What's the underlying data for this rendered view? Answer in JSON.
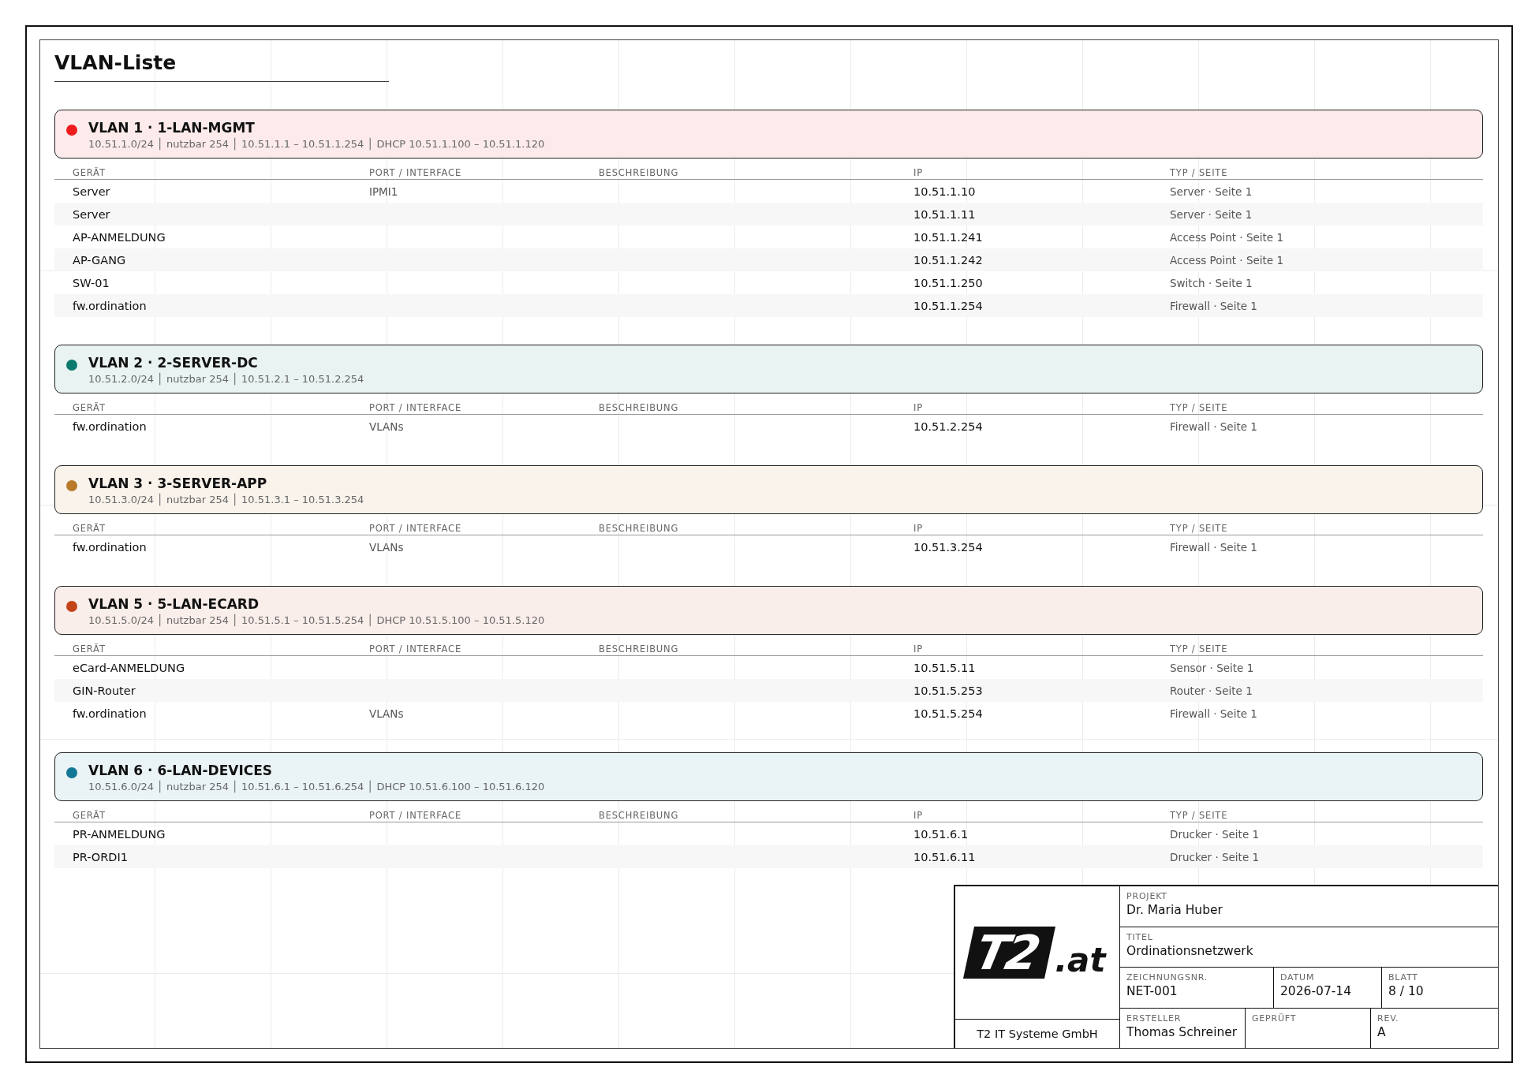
{
  "title": "VLAN-Liste",
  "vlans": [
    {
      "name": "VLAN 1 · 1-LAN-MGMT",
      "color": "#ee1c1c",
      "details": "10.51.1.0/24 │ nutzbar 254 │ 10.51.1.1 – 10.51.1.254 │ DHCP 10.51.1.100 – 10.51.1.120",
      "columns": [
        "GERÄT",
        "PORT / INTERFACE",
        "BESCHREIBUNG",
        "IP",
        "TYP / SEITE"
      ],
      "rows": [
        {
          "device": "Server",
          "port": "IPMI1",
          "ip": "10.51.1.10",
          "type": "Server · Seite 1"
        },
        {
          "device": "Server",
          "ip": "10.51.1.11",
          "type": "Server · Seite 1"
        },
        {
          "device": "AP-ANMELDUNG",
          "ip": "10.51.1.241",
          "type": "Access Point · Seite 1"
        },
        {
          "device": "AP-GANG",
          "ip": "10.51.1.242",
          "type": "Access Point · Seite 1"
        },
        {
          "device": "SW-01",
          "ip": "10.51.1.250",
          "type": "Switch · Seite 1"
        },
        {
          "device": "fw.ordination",
          "ip": "10.51.1.254",
          "type": "Firewall · Seite 1"
        }
      ]
    },
    {
      "name": "VLAN 2 · 2-SERVER-DC",
      "color": "#0e7a6e",
      "details": "10.51.2.0/24 │ nutzbar 254 │ 10.51.2.1 – 10.51.2.254",
      "columns": [
        "GERÄT",
        "PORT / INTERFACE",
        "BESCHREIBUNG",
        "IP",
        "TYP / SEITE"
      ],
      "rows": [
        {
          "device": "fw.ordination",
          "port": "VLANs",
          "ip": "10.51.2.254",
          "type": "Firewall · Seite 1"
        }
      ]
    },
    {
      "name": "VLAN 3 · 3-SERVER-APP",
      "color": "#b87a2a",
      "details": "10.51.3.0/24 │ nutzbar 254 │ 10.51.3.1 – 10.51.3.254",
      "columns": [
        "GERÄT",
        "PORT / INTERFACE",
        "BESCHREIBUNG",
        "IP",
        "TYP / SEITE"
      ],
      "rows": [
        {
          "device": "fw.ordination",
          "port": "VLANs",
          "ip": "10.51.3.254",
          "type": "Firewall · Seite 1"
        }
      ]
    },
    {
      "name": "VLAN 5 · 5-LAN-ECARD",
      "color": "#c4441a",
      "details": "10.51.5.0/24 │ nutzbar 254 │ 10.51.5.1 – 10.51.5.254 │ DHCP 10.51.5.100 – 10.51.5.120",
      "columns": [
        "GERÄT",
        "PORT / INTERFACE",
        "BESCHREIBUNG",
        "IP",
        "TYP / SEITE"
      ],
      "rows": [
        {
          "device": "eCard-ANMELDUNG",
          "ip": "10.51.5.11",
          "type": "Sensor · Seite 1"
        },
        {
          "device": "GIN-Router",
          "ip": "10.51.5.253",
          "type": "Router · Seite 1"
        },
        {
          "device": "fw.ordination",
          "port": "VLANs",
          "ip": "10.51.5.254",
          "type": "Firewall · Seite 1"
        }
      ]
    },
    {
      "name": "VLAN 6 · 6-LAN-DEVICES",
      "color": "#137895",
      "details": "10.51.6.0/24 │ nutzbar 254 │ 10.51.6.1 – 10.51.6.254 │ DHCP 10.51.6.100 – 10.51.6.120",
      "columns": [
        "GERÄT",
        "PORT / INTERFACE",
        "BESCHREIBUNG",
        "IP",
        "TYP / SEITE"
      ],
      "rows": [
        {
          "device": "PR-ANMELDUNG",
          "ip": "10.51.6.1",
          "type": "Drucker · Seite 1"
        },
        {
          "device": "PR-ORDI1",
          "ip": "10.51.6.11",
          "type": "Drucker · Seite 1"
        }
      ]
    }
  ],
  "title_block": {
    "logo": {
      "mark": "T2",
      "suffix": ".at"
    },
    "company": "T2 IT Systeme GmbH",
    "rows": [
      [
        {
          "label": "PROJEKT",
          "value": "Dr. Maria Huber"
        }
      ],
      [
        {
          "label": "TITEL",
          "value": "Ordinationsnetzwerk"
        }
      ],
      [
        {
          "label": "ZEICHNUNGSNR.",
          "value": "NET-001"
        },
        {
          "label": "DATUM",
          "value": "2026-07-14"
        },
        {
          "label": "BLATT",
          "value": "8 / 10"
        }
      ],
      [
        {
          "label": "ERSTELLER",
          "value": "Thomas Schreiner"
        },
        {
          "label": "GEPRÜFT"
        },
        {
          "label": "REV.",
          "value": "A"
        }
      ]
    ]
  }
}
